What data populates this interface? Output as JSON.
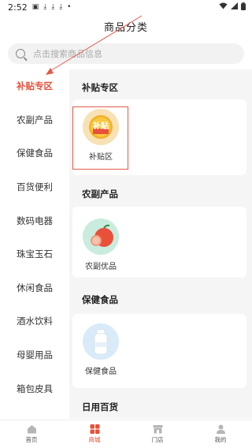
{
  "status": {
    "time": "2:52",
    "dot": "•"
  },
  "header": {
    "title": "商品分类"
  },
  "search": {
    "placeholder": "点击搜索商品信息"
  },
  "sidebar": {
    "items": [
      {
        "label": "补贴专区"
      },
      {
        "label": "农副产品"
      },
      {
        "label": "保健食品"
      },
      {
        "label": "百货便利"
      },
      {
        "label": "数码电器"
      },
      {
        "label": "珠宝玉石"
      },
      {
        "label": "休闲食品"
      },
      {
        "label": "酒水饮料"
      },
      {
        "label": "母婴用品"
      },
      {
        "label": "箱包皮具"
      }
    ]
  },
  "content": {
    "sections": [
      {
        "title": "补贴专区",
        "products": [
          {
            "label": "补贴区",
            "icon_text": "补贴"
          }
        ]
      },
      {
        "title": "农副产品",
        "products": [
          {
            "label": "农副优品"
          }
        ]
      },
      {
        "title": "保健食品",
        "products": [
          {
            "label": "保健食品"
          }
        ]
      },
      {
        "title": "日用百货"
      }
    ]
  },
  "tabbar": {
    "items": [
      {
        "label": "首页"
      },
      {
        "label": "商城"
      },
      {
        "label": "门店"
      },
      {
        "label": "我的"
      }
    ]
  },
  "colors": {
    "accent": "#e8503a",
    "annotation": "#e25a4a"
  }
}
